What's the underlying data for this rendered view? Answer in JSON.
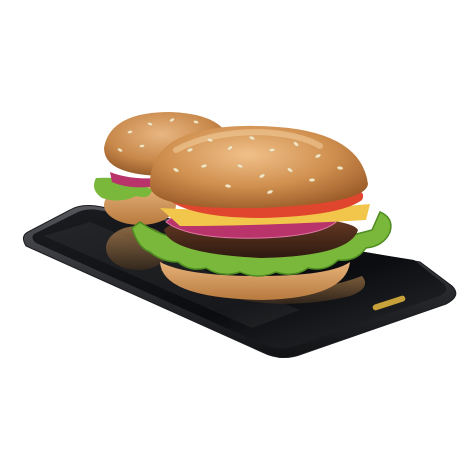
{
  "scene": {
    "subject": "burger-on-smartphone",
    "background": "#ffffff",
    "colors": {
      "phone_body": "#2b2d31",
      "phone_screen": "#0c0d10",
      "phone_edge": "#8a8c90",
      "bun_top": "#c98a4e",
      "bun_highlight": "#e7b27b",
      "sesame": "#f3e6c7",
      "lettuce": "#79b83a",
      "lettuce_dark": "#4e8c22",
      "tomato": "#e0452e",
      "onion": "#b8346b",
      "cheese": "#f2c64a",
      "patty": "#4a2a1c",
      "bun_bottom": "#d39a5f"
    }
  }
}
